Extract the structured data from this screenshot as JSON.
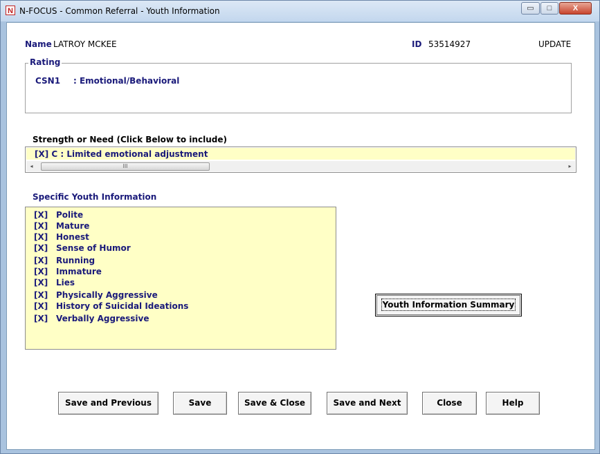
{
  "window": {
    "title": "N-FOCUS - Common Referral - Youth Information",
    "app_icon_glyph": "N",
    "minimize_glyph": "▭",
    "maximize_glyph": "□",
    "close_glyph": "X"
  },
  "header": {
    "name_label": "Name",
    "name_value": "LATROY MCKEE",
    "id_label": "ID",
    "id_value": "53514927",
    "mode": "UPDATE"
  },
  "rating": {
    "group_title": "Rating",
    "code": "CSN1",
    "description": ": Emotional/Behavioral"
  },
  "strength": {
    "label": "Strength or Need (Click Below to include)",
    "selected_item": "[X]   C  : Limited emotional adjustment",
    "scroll_left": "◂",
    "scroll_right": "▸",
    "scroll_thumb_grip": "III"
  },
  "youth_info": {
    "label": "Specific Youth Information",
    "items": [
      {
        "mark": "[X]",
        "text": "Polite"
      },
      {
        "mark": "[X]",
        "text": "Mature"
      },
      {
        "mark": "[X]",
        "text": "Honest"
      },
      {
        "mark": "[X]",
        "text": "Sense of Humor"
      },
      {
        "mark": "[X]",
        "text": "Running"
      },
      {
        "mark": "[X]",
        "text": "Immature"
      },
      {
        "mark": "[X]",
        "text": "Lies"
      },
      {
        "mark": "[X]",
        "text": "Physically Aggressive"
      },
      {
        "mark": "[X]",
        "text": "History of Suicidal Ideations"
      },
      {
        "mark": "[X]",
        "text": "Verbally Aggressive"
      }
    ],
    "summary_button": "Youth Information Summary"
  },
  "buttons": {
    "save_previous": "Save and Previous",
    "save": "Save",
    "save_close": "Save & Close",
    "save_next": "Save and Next",
    "close": "Close",
    "help": "Help"
  },
  "colors": {
    "label_text": "#1a1a7a",
    "list_background": "#ffffc6",
    "window_frame": "#a9c3df"
  }
}
